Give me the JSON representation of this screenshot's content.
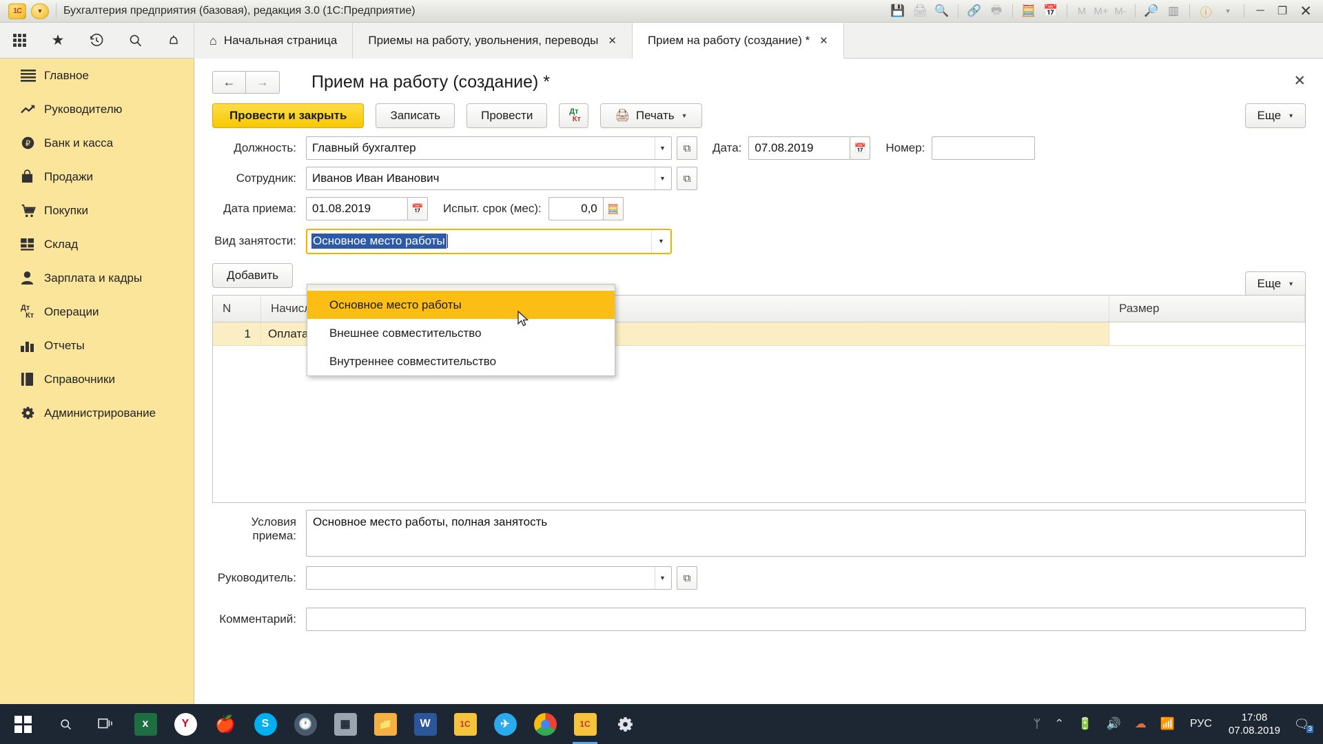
{
  "titlebar": {
    "app_title": "Бухгалтерия предприятия (базовая), редакция 3.0  (1С:Предприятие)",
    "logo_text": "1C",
    "icons": [
      "save-icon",
      "print-icon",
      "print-preview-icon",
      "link-export-icon",
      "print-form-icon",
      "calculator-icon",
      "calendar-icon",
      "memory-m",
      "memory-m-plus",
      "memory-m-minus",
      "zoom-in-icon",
      "panels-icon",
      "info-icon",
      "chevron-down-icon"
    ],
    "memory": {
      "m": "M",
      "m_plus": "M+",
      "m_minus": "M-"
    },
    "window_buttons": {
      "minimize": "─",
      "maximize": "❐",
      "close": "✕"
    }
  },
  "navbar": {
    "icons": [
      "apps-grid-icon",
      "favorites-star-icon",
      "history-clock-icon",
      "search-icon",
      "notifications-bell-icon"
    ]
  },
  "tabs": [
    {
      "label": "Начальная страница",
      "icon": "home-icon",
      "closable": false,
      "active": false
    },
    {
      "label": "Приемы на работу, увольнения, переводы",
      "closable": true,
      "active": false
    },
    {
      "label": "Прием на работу (создание) *",
      "closable": true,
      "active": true
    }
  ],
  "sidebar": {
    "items": [
      {
        "label": "Главное",
        "icon": "menu-lines-icon"
      },
      {
        "label": "Руководителю",
        "icon": "trend-up-icon"
      },
      {
        "label": "Банк и касса",
        "icon": "ruble-circle-icon"
      },
      {
        "label": "Продажи",
        "icon": "shopping-bag-icon"
      },
      {
        "label": "Покупки",
        "icon": "shopping-cart-icon"
      },
      {
        "label": "Склад",
        "icon": "warehouse-grid-icon"
      },
      {
        "label": "Зарплата и кадры",
        "icon": "person-icon"
      },
      {
        "label": "Операции",
        "icon": "debit-credit-icon"
      },
      {
        "label": "Отчеты",
        "icon": "bar-chart-icon"
      },
      {
        "label": "Справочники",
        "icon": "book-icon"
      },
      {
        "label": "Администрирование",
        "icon": "gear-icon"
      }
    ]
  },
  "form": {
    "title": "Прием на работу (создание) *",
    "back_arrow": "←",
    "forward_arrow": "→",
    "close": "✕",
    "toolbar": {
      "post_and_close": "Провести и закрыть",
      "write": "Записать",
      "post": "Провести",
      "dt": "Дт",
      "kt": "Кт",
      "print": "Печать",
      "print_caret": "▼",
      "more": "Еще",
      "more_caret": "▼"
    },
    "fields": {
      "position_label": "Должность:",
      "position_value": "Главный бухгалтер",
      "date_label": "Дата:",
      "date_value": "07.08.2019",
      "number_label": "Номер:",
      "number_value": "",
      "employee_label": "Сотрудник:",
      "employee_value": "Иванов Иван Иванович",
      "hire_date_label": "Дата приема:",
      "hire_date_value": "01.08.2019",
      "probation_label": "Испыт. срок (мес):",
      "probation_value": "0,0",
      "employment_type_label": "Вид занятости:",
      "employment_type_value": "Основное место работы"
    },
    "dropdown": {
      "open": true,
      "options": [
        {
          "label": "Основное место работы",
          "highlighted": true
        },
        {
          "label": "Внешнее совместительство",
          "highlighted": false
        },
        {
          "label": "Внутреннее совместительство",
          "highlighted": false
        }
      ]
    },
    "table_toolbar": {
      "add": "Добавить",
      "more": "Еще",
      "more_caret": "▼"
    },
    "table": {
      "columns": [
        "N",
        "Начисление",
        "Размер"
      ],
      "rows": [
        {
          "n": "1",
          "nach": "Оплата по окладу",
          "size": ""
        }
      ]
    },
    "bottom": {
      "conditions_label": "Условия приема:",
      "conditions_value": "Основное место работы, полная занятость",
      "manager_label": "Руководитель:",
      "manager_value": "",
      "comment_label": "Комментарий:",
      "comment_value": ""
    }
  },
  "taskbar": {
    "start_icon": "windows-start-icon",
    "items": [
      {
        "name": "search-icon"
      },
      {
        "name": "task-view-icon"
      },
      {
        "name": "excel-icon",
        "letter": "x",
        "color": "#1D6F42"
      },
      {
        "name": "yandex-browser-icon",
        "letter": "Y",
        "color": "#ffffff"
      },
      {
        "name": "apple-icon",
        "letter": "",
        "color": "#c0392b"
      },
      {
        "name": "skype-icon",
        "letter": "S",
        "color": "#00aff0"
      },
      {
        "name": "clock-app-icon",
        "letter": "",
        "color": "#3c4a5a"
      },
      {
        "name": "calculator-icon",
        "letter": "",
        "color": "#8e9aa6"
      },
      {
        "name": "file-explorer-icon",
        "letter": "",
        "color": "#f5b041"
      },
      {
        "name": "word-icon",
        "letter": "W",
        "color": "#2B579A"
      },
      {
        "name": "onec-icon",
        "letter": "1C",
        "color": "#f5c33c"
      },
      {
        "name": "telegram-icon",
        "letter": "",
        "color": "#2aabee"
      },
      {
        "name": "chrome-icon",
        "letter": "",
        "color": "#4285F4"
      },
      {
        "name": "onec-enterprise-icon",
        "letter": "1C",
        "color": "#f5c33c"
      },
      {
        "name": "settings-gear-icon",
        "letter": "",
        "color": "#cfd6de"
      }
    ],
    "tray": {
      "share_icon": "people-share-icon",
      "chevron_up": "⌃",
      "battery_icon": "battery-icon",
      "volume_icon": "🔊",
      "onedrive_icon": "cloud-icon",
      "wifi_icon": "wifi-icon",
      "language": "РУС",
      "time": "17:08",
      "date": "07.08.2019",
      "notification_icon": "notification-icon",
      "notification_count": "3"
    }
  }
}
